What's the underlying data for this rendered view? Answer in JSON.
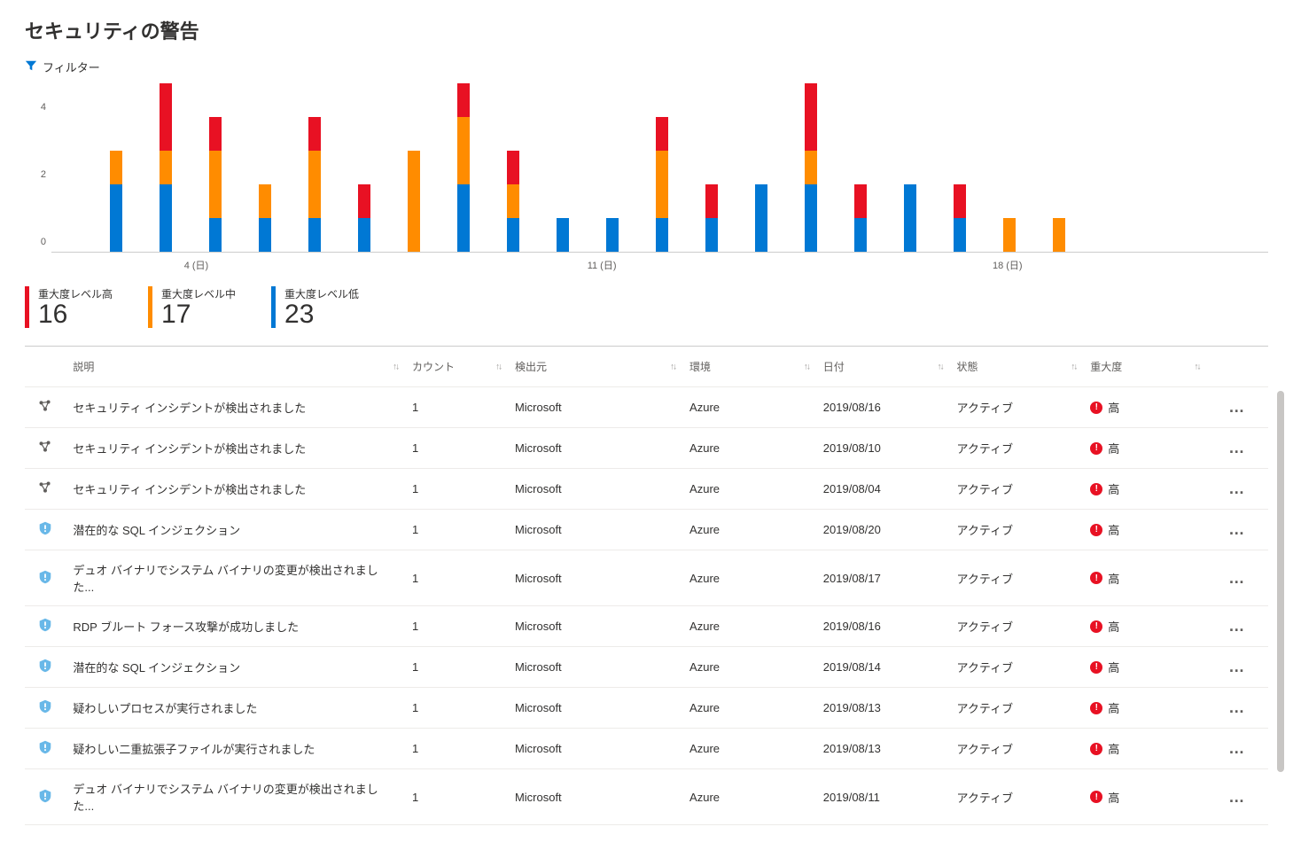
{
  "page_title": "セキュリティの警告",
  "filter_label": "フィルター",
  "chart_data": {
    "type": "bar",
    "stacked": true,
    "ylim": [
      0,
      5
    ],
    "yticks": [
      0,
      2,
      4
    ],
    "xticks": [
      {
        "index": 2,
        "label": "4 (日)"
      },
      {
        "index": 9,
        "label": "11 (日)"
      },
      {
        "index": 16,
        "label": "18 (日)"
      }
    ],
    "series_names": [
      "low",
      "med",
      "high"
    ],
    "days": [
      {
        "low": 0,
        "med": 0,
        "high": 0
      },
      {
        "low": 2,
        "med": 1,
        "high": 0
      },
      {
        "low": 2,
        "med": 1,
        "high": 2
      },
      {
        "low": 1,
        "med": 2,
        "high": 1
      },
      {
        "low": 1,
        "med": 1,
        "high": 0
      },
      {
        "low": 1,
        "med": 2,
        "high": 1
      },
      {
        "low": 1,
        "med": 0,
        "high": 1
      },
      {
        "low": 0,
        "med": 3,
        "high": 0
      },
      {
        "low": 2,
        "med": 2,
        "high": 1
      },
      {
        "low": 1,
        "med": 1,
        "high": 1
      },
      {
        "low": 1,
        "med": 0,
        "high": 0
      },
      {
        "low": 1,
        "med": 0,
        "high": 0
      },
      {
        "low": 1,
        "med": 2,
        "high": 1
      },
      {
        "low": 1,
        "med": 0,
        "high": 1
      },
      {
        "low": 2,
        "med": 0,
        "high": 0
      },
      {
        "low": 2,
        "med": 1,
        "high": 2
      },
      {
        "low": 1,
        "med": 0,
        "high": 1
      },
      {
        "low": 2,
        "med": 0,
        "high": 0
      },
      {
        "low": 1,
        "med": 0,
        "high": 1
      },
      {
        "low": 0,
        "med": 1,
        "high": 0
      },
      {
        "low": 0,
        "med": 1,
        "high": 0
      }
    ]
  },
  "summary": [
    {
      "key": "high",
      "label": "重大度レベル高",
      "value": "16",
      "color": "sb-high"
    },
    {
      "key": "med",
      "label": "重大度レベル中",
      "value": "17",
      "color": "sb-med"
    },
    {
      "key": "low",
      "label": "重大度レベル低",
      "value": "23",
      "color": "sb-low"
    }
  ],
  "table": {
    "headers": {
      "description": "説明",
      "count": "カウント",
      "source": "検出元",
      "environment": "環境",
      "date": "日付",
      "state": "状態",
      "severity": "重大度"
    },
    "rows": [
      {
        "icon": "incident",
        "description": "セキュリティ インシデントが検出されました",
        "count": "1",
        "source": "Microsoft",
        "environment": "Azure",
        "date": "2019/08/16",
        "state": "アクティブ",
        "severity": "高"
      },
      {
        "icon": "incident",
        "description": "セキュリティ インシデントが検出されました",
        "count": "1",
        "source": "Microsoft",
        "environment": "Azure",
        "date": "2019/08/10",
        "state": "アクティブ",
        "severity": "高"
      },
      {
        "icon": "incident",
        "description": "セキュリティ インシデントが検出されました",
        "count": "1",
        "source": "Microsoft",
        "environment": "Azure",
        "date": "2019/08/04",
        "state": "アクティブ",
        "severity": "高"
      },
      {
        "icon": "shield",
        "description": "潜在的な SQL インジェクション",
        "count": "1",
        "source": "Microsoft",
        "environment": "Azure",
        "date": "2019/08/20",
        "state": "アクティブ",
        "severity": "高"
      },
      {
        "icon": "shield",
        "description": "デュオ バイナリでシステム バイナリの変更が検出されました...",
        "count": "1",
        "source": "Microsoft",
        "environment": "Azure",
        "date": "2019/08/17",
        "state": "アクティブ",
        "severity": "高"
      },
      {
        "icon": "shield",
        "description": "RDP ブルート フォース攻撃が成功しました",
        "count": "1",
        "source": "Microsoft",
        "environment": "Azure",
        "date": "2019/08/16",
        "state": "アクティブ",
        "severity": "高"
      },
      {
        "icon": "shield",
        "description": "潜在的な SQL インジェクション",
        "count": "1",
        "source": "Microsoft",
        "environment": "Azure",
        "date": "2019/08/14",
        "state": "アクティブ",
        "severity": "高"
      },
      {
        "icon": "shield",
        "description": "疑わしいプロセスが実行されました",
        "count": "1",
        "source": "Microsoft",
        "environment": "Azure",
        "date": "2019/08/13",
        "state": "アクティブ",
        "severity": "高"
      },
      {
        "icon": "shield",
        "description": "疑わしい二重拡張子ファイルが実行されました",
        "count": "1",
        "source": "Microsoft",
        "environment": "Azure",
        "date": "2019/08/13",
        "state": "アクティブ",
        "severity": "高"
      },
      {
        "icon": "shield",
        "description": "デュオ バイナリでシステム バイナリの変更が検出されました...",
        "count": "1",
        "source": "Microsoft",
        "environment": "Azure",
        "date": "2019/08/11",
        "state": "アクティブ",
        "severity": "高"
      }
    ]
  },
  "more_glyph": "…"
}
